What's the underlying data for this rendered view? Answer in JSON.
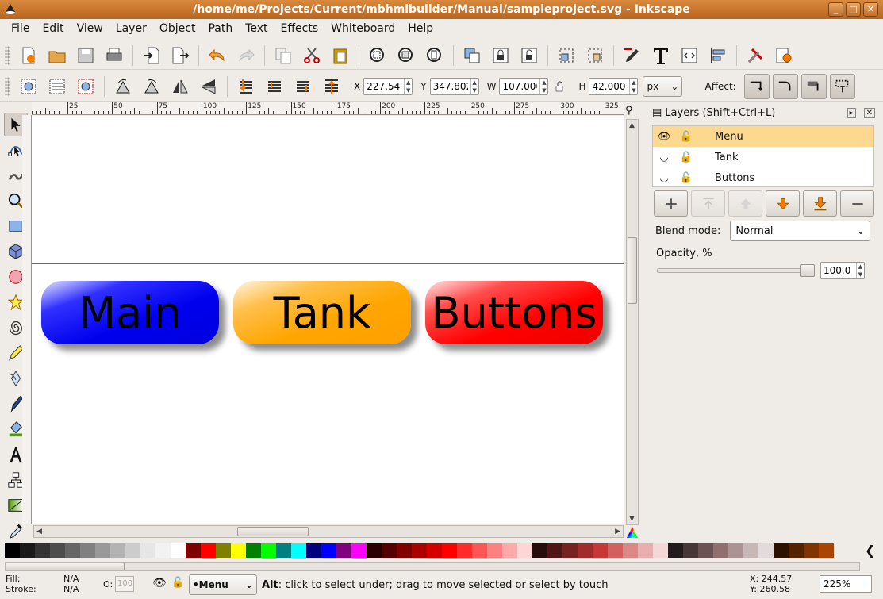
{
  "window": {
    "title": "/home/me/Projects/Current/mbhmibuilder/Manual/sampleproject.svg - Inkscape",
    "buttons": [
      "_",
      "□",
      "✕"
    ]
  },
  "menu": [
    "File",
    "Edit",
    "View",
    "Layer",
    "Object",
    "Path",
    "Text",
    "Effects",
    "Whiteboard",
    "Help"
  ],
  "toolbar_main": {
    "icons": [
      "new-icon",
      "open-icon",
      "save-icon",
      "print-icon",
      "import-icon",
      "export-icon",
      "undo-icon",
      "redo-icon",
      "duplicate-icon",
      "cut-icon",
      "paste-icon",
      "zoom-selection-icon",
      "zoom-drawing-icon",
      "zoom-page-icon",
      "group-icon",
      "lock-icon",
      "unlock-icon",
      "clone-icon",
      "unclone-icon",
      "fill-stroke-icon",
      "text-font-icon",
      "xml-editor-icon",
      "align-icon",
      "preferences-icon",
      "document-properties-icon"
    ]
  },
  "toolbar_select": {
    "x_label": "X",
    "x_value": "227.547",
    "y_label": "Y",
    "y_value": "347.802",
    "w_label": "W",
    "w_value": "107.000",
    "h_label": "H",
    "h_value": "42.000",
    "unit": "px",
    "affect_label": "Affect:"
  },
  "ruler": {
    "labels": [
      "25",
      "50",
      "75",
      "100",
      "125",
      "150",
      "175",
      "200",
      "225",
      "250",
      "275",
      "300",
      "325"
    ]
  },
  "canvas": {
    "buttons": [
      {
        "label": "Main",
        "color": "#0000ee"
      },
      {
        "label": "Tank",
        "color": "#ffa500"
      },
      {
        "label": "Buttons",
        "color": "#ff0000"
      }
    ]
  },
  "layers_panel": {
    "title": "Layers (Shift+Ctrl+L)",
    "layers": [
      {
        "name": "Menu",
        "visible": true,
        "locked": false,
        "selected": true
      },
      {
        "name": "Tank",
        "visible": false,
        "locked": false,
        "selected": false
      },
      {
        "name": "Buttons",
        "visible": false,
        "locked": false,
        "selected": false
      }
    ],
    "blend_label": "Blend mode:",
    "blend_value": "Normal",
    "opacity_label": "Opacity, %",
    "opacity_value": "100.0"
  },
  "palette": [
    "#000000",
    "#1a1a1a",
    "#333333",
    "#4d4d4d",
    "#666666",
    "#808080",
    "#999999",
    "#b3b3b3",
    "#cccccc",
    "#e6e6e6",
    "#f2f2f2",
    "#ffffff",
    "#800000",
    "#ff0000",
    "#808000",
    "#ffff00",
    "#008000",
    "#00ff00",
    "#008080",
    "#00ffff",
    "#000080",
    "#0000ff",
    "#800080",
    "#ff00ff",
    "#2b0000",
    "#550000",
    "#800000",
    "#aa0000",
    "#d40000",
    "#ff0000",
    "#ff2a2a",
    "#ff5555",
    "#ff8080",
    "#ffaaaa",
    "#ffd5d5",
    "#280b0b",
    "#501616",
    "#782121",
    "#a02c2c",
    "#c83737",
    "#d35f5f",
    "#de8787",
    "#e9afaf",
    "#f4d7d7",
    "#241c1c",
    "#483737",
    "#6c5353",
    "#916f6f",
    "#ac9393",
    "#c8b7b7",
    "#e3dbdb",
    "#2b1100",
    "#552200",
    "#803300",
    "#aa4400"
  ],
  "status": {
    "fill_label": "Fill:",
    "fill_value": "N/A",
    "stroke_label": "Stroke:",
    "stroke_value": "N/A",
    "o_label": "O:",
    "o_value": "100",
    "current_layer": "•Menu",
    "message_key": "Alt",
    "message": ": click to select under; drag to move selected or select by touch",
    "x_label": "X:",
    "x_value": "244.57",
    "y_label": "Y:",
    "y_value": "260.58",
    "zoom": "225%"
  }
}
